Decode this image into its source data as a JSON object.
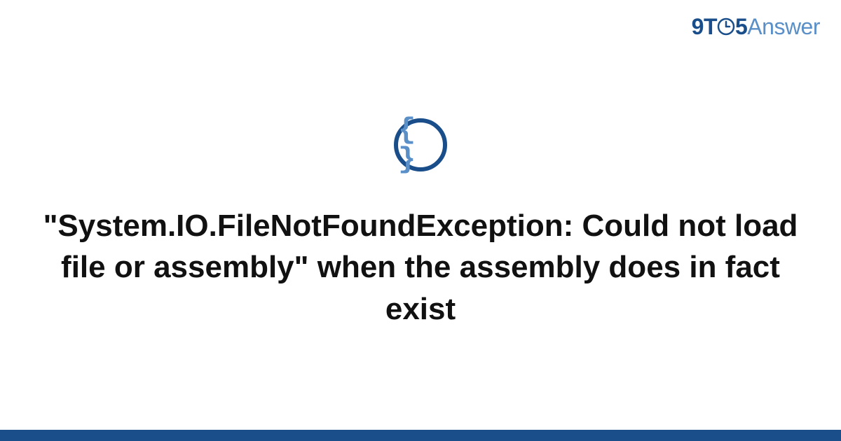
{
  "logo": {
    "nine_t": "9T",
    "five": "5",
    "answer": "Answer"
  },
  "icon": {
    "braces": "{ }"
  },
  "title": "\"System.IO.FileNotFoundException: Could not load file or assembly\" when the assembly does in fact exist",
  "colors": {
    "brand_dark": "#1a4e8a",
    "brand_light": "#5a8fc7"
  }
}
